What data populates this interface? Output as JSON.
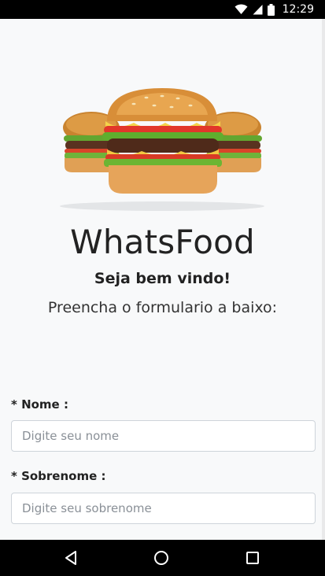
{
  "status_bar": {
    "time": "12:29",
    "icons": [
      "wifi-icon",
      "signal-icon",
      "battery-icon"
    ]
  },
  "app": {
    "title": "WhatsFood",
    "welcome": "Seja bem vindo!",
    "instruction": "Preencha o formulario a baixo:",
    "hero_image": "burgers-image"
  },
  "form": {
    "nome": {
      "label": "* Nome :",
      "placeholder": "Digite seu nome",
      "value": ""
    },
    "sobrenome": {
      "label": "* Sobrenome :",
      "placeholder": "Digite seu sobrenome",
      "value": ""
    }
  },
  "nav_bar": {
    "buttons": [
      "back-icon",
      "home-icon",
      "recents-icon"
    ]
  },
  "colors": {
    "background": "#f8f9fa",
    "text": "#222222",
    "input_border": "#ced4da",
    "system_bar": "#000000"
  }
}
